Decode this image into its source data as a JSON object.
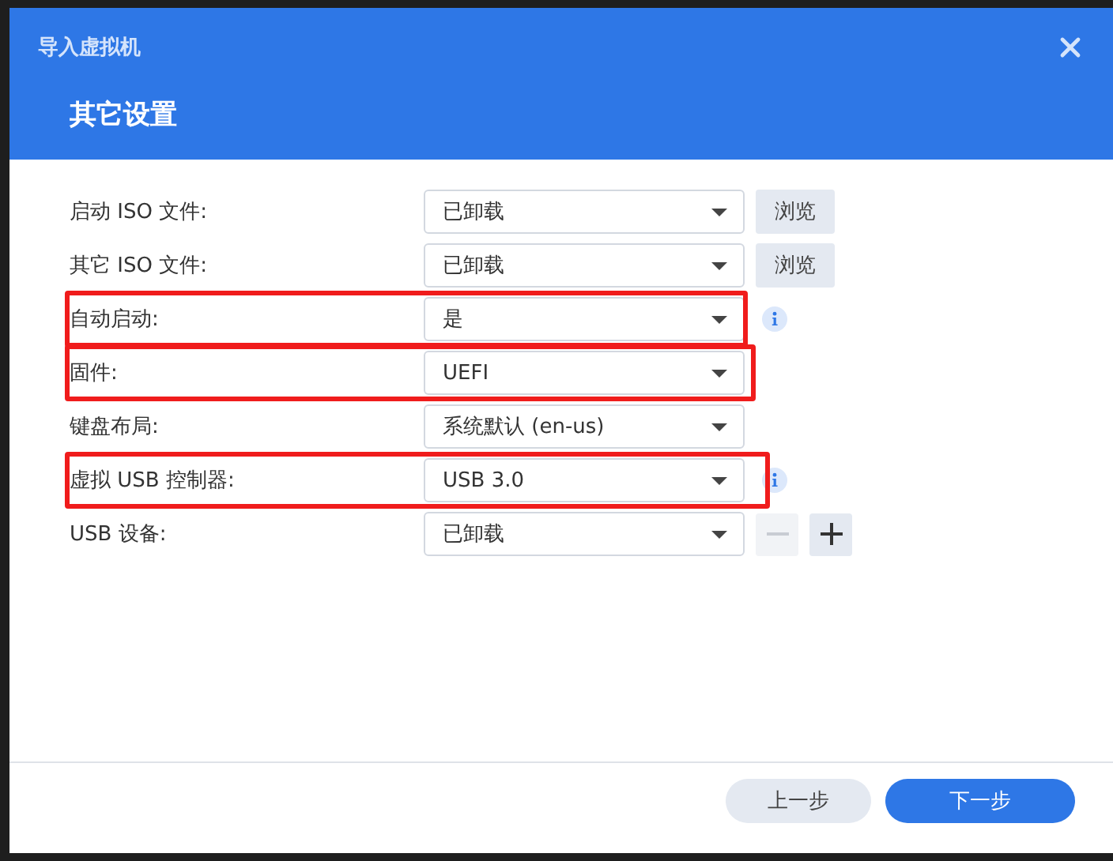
{
  "window": {
    "title": "导入虚拟机"
  },
  "heading": "其它设置",
  "rows": [
    {
      "label": "启动 ISO 文件:",
      "value": "已卸载",
      "highlighted": false,
      "kind": "browse",
      "button": "浏览"
    },
    {
      "label": "其它 ISO 文件:",
      "value": "已卸载",
      "highlighted": false,
      "kind": "browse",
      "button": "浏览"
    },
    {
      "label": "自动启动:",
      "value": "是",
      "highlighted": true,
      "kind": "info"
    },
    {
      "label": "固件:",
      "value": "UEFI",
      "highlighted": true,
      "kind": "plain"
    },
    {
      "label": "键盘布局:",
      "value": "系统默认 (en-us)",
      "highlighted": false,
      "kind": "plain"
    },
    {
      "label": "虚拟 USB 控制器:",
      "value": "USB 3.0",
      "highlighted": true,
      "kind": "info"
    },
    {
      "label": "USB 设备:",
      "value": "已卸载",
      "highlighted": false,
      "kind": "addremove",
      "remove_disabled": true
    }
  ],
  "footer": {
    "back": "上一步",
    "next": "下一步"
  }
}
